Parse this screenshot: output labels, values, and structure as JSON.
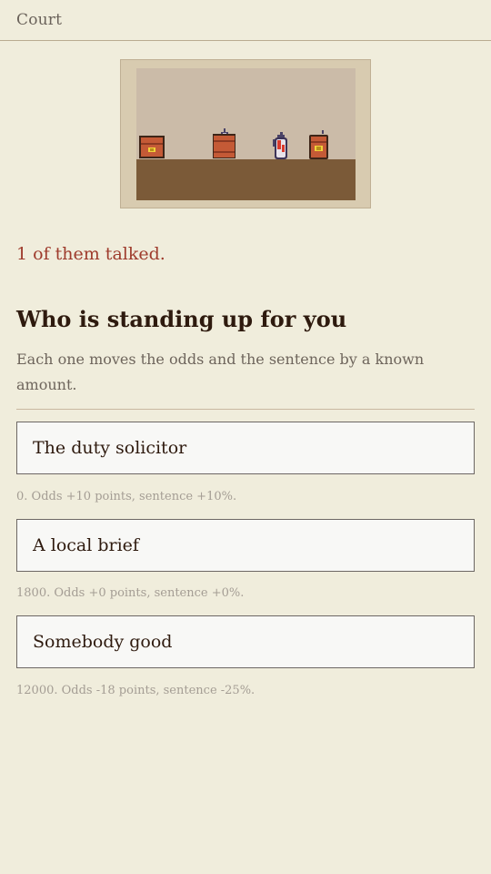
{
  "header": {
    "title": "Court"
  },
  "scene": {
    "colors": {
      "wall": "#cbbba8",
      "floor": "#7b5a38",
      "frame": "#d8cbb0"
    },
    "objects": [
      "briefcase-icon",
      "lunchbox-icon",
      "fire-extinguisher-icon",
      "jar-icon"
    ]
  },
  "status": {
    "talked_text": "1 of them talked."
  },
  "section": {
    "title": "Who is standing up for you",
    "subtitle": "Each one moves the odds and the sentence by a known amount."
  },
  "options": [
    {
      "label": "The duty solicitor",
      "description": "0. Odds +10 points, sentence +10%."
    },
    {
      "label": "A local brief",
      "description": "1800. Odds +0 points, sentence +0%."
    },
    {
      "label": "Somebody good",
      "description": "12000. Odds -18 points, sentence -25%."
    }
  ],
  "colors": {
    "background": "#f0eddc",
    "accent": "#9e3b2c",
    "heading": "#2e1a0e"
  }
}
